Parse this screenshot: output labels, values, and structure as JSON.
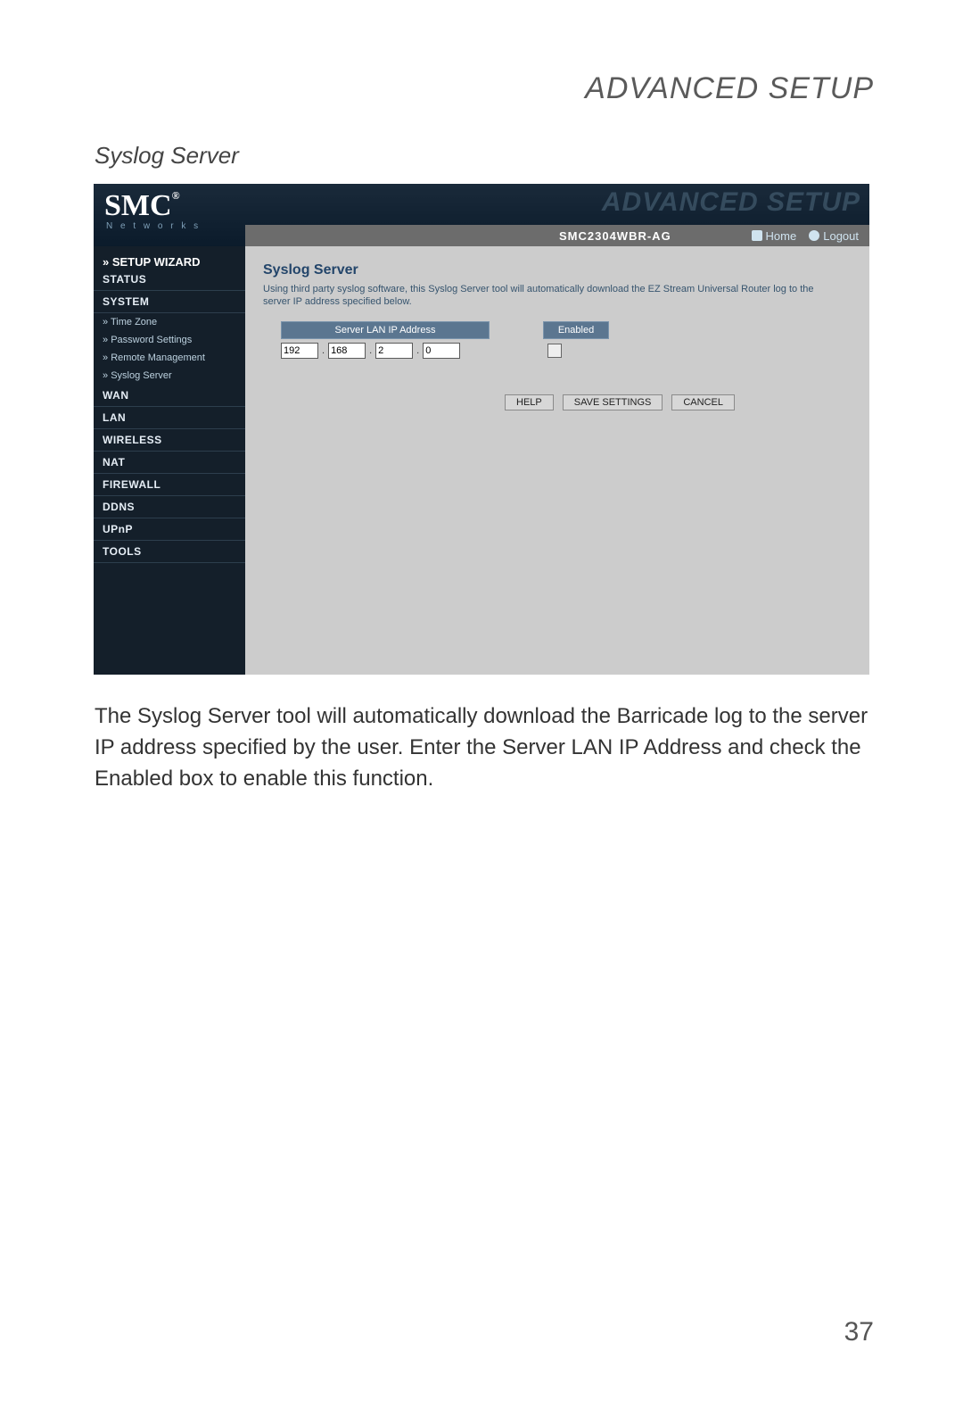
{
  "page": {
    "header": "ADVANCED SETUP",
    "section_title": "Syslog Server",
    "body_copy": "The Syslog Server tool will automatically download the Barricade log to the server IP address specified by the user. Enter the Server LAN IP Address and check the Enabled box to enable this function.",
    "page_number": "37"
  },
  "router": {
    "logo": "SMC",
    "logo_reg": "®",
    "logo_sub": "N e t w o r k s",
    "watermark": "ADVANCED SETUP",
    "model": "SMC2304WBR-AG",
    "toplinks": {
      "home": "Home",
      "logout": "Logout"
    },
    "sidebar": {
      "setup_wizard": "SETUP WIZARD",
      "items": [
        "STATUS",
        "SYSTEM",
        "WAN",
        "LAN",
        "WIRELESS",
        "NAT",
        "FIREWALL",
        "DDNS",
        "UPnP",
        "TOOLS"
      ],
      "system_sub": [
        "Time Zone",
        "Password Settings",
        "Remote Management",
        "Syslog Server"
      ]
    },
    "content": {
      "title": "Syslog Server",
      "desc": "Using third party syslog software, this Syslog Server tool will automatically download the EZ Stream Universal Router log to the server IP address specified below.",
      "ip_header": "Server LAN IP Address",
      "enabled_header": "Enabled",
      "ip": {
        "o1": "192",
        "o2": "168",
        "o3": "2",
        "o4": "0"
      },
      "buttons": {
        "help": "HELP",
        "save": "SAVE SETTINGS",
        "cancel": "CANCEL"
      }
    }
  }
}
